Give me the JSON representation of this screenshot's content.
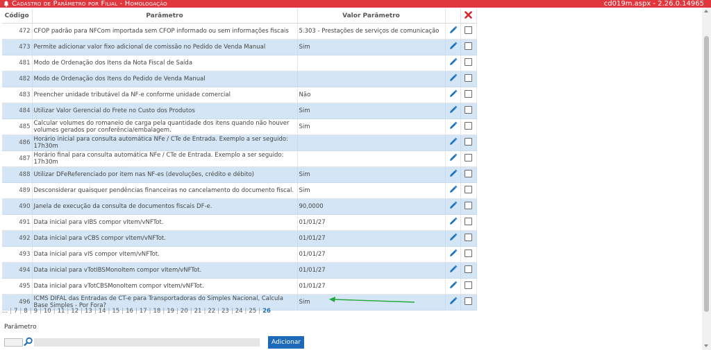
{
  "header": {
    "title": "Cadastro de Parâmetro por Filial  - Homologação",
    "version": "cd019m.aspx - 2.26.0.14965",
    "color": "#e0363e"
  },
  "table": {
    "columns": [
      "Código",
      "Parâmetro",
      "Valor Parâmetro"
    ],
    "delete_icon": "red-x-icon",
    "rows": [
      {
        "code": "472",
        "param": "CFOP padrão para NFCom importada sem CFOP informado ou sem informações fiscais",
        "value": "5.303 - Prestações de serviços de comunicação"
      },
      {
        "code": "473",
        "param": "Permite adicionar valor fixo adicional de comissão no Pedido de Venda Manual",
        "value": "Sim"
      },
      {
        "code": "481",
        "param": "Modo de Ordenação dos Itens da Nota Fiscal de Saída",
        "value": ""
      },
      {
        "code": "482",
        "param": "Modo de Ordenação dos Itens do Pedido de Venda Manual",
        "value": ""
      },
      {
        "code": "483",
        "param": "Preencher unidade tributável da NF-e conforme unidade comercial",
        "value": "Não"
      },
      {
        "code": "484",
        "param": "Utilizar Valor Gerencial do Frete no Custo dos Produtos",
        "value": "Sim"
      },
      {
        "code": "485",
        "param": "Calcular volumes do romaneio de carga pela quantidade dos itens quando não houver volumes gerados por conferência/embalagem.",
        "value": "Sim"
      },
      {
        "code": "486",
        "param": "Horário inicial para consulta automática NFe / CTe de Entrada. Exemplo a ser seguido: 17h30m",
        "value": ""
      },
      {
        "code": "487",
        "param": "Horário final para consulta automática NFe / CTe de Entrada. Exemplo a ser seguido: 17h30m",
        "value": ""
      },
      {
        "code": "488",
        "param": "Utilizar DFeReferenciado por item nas NF-es (devoluções, crédito e débito)",
        "value": "Sim"
      },
      {
        "code": "489",
        "param": "Desconsiderar quaisquer pendências financeiras no cancelamento do documento fiscal.",
        "value": "Sim"
      },
      {
        "code": "490",
        "param": "Janela de execução da consulta de documentos fiscais DF-e.",
        "value": "90,0000"
      },
      {
        "code": "491",
        "param": "Data inicial para vIBS compor vItem/vNFTot.",
        "value": "01/01/27"
      },
      {
        "code": "492",
        "param": "Data inicial para vCBS compor vItem/vNFTot.",
        "value": "01/01/27"
      },
      {
        "code": "493",
        "param": "Data inicial para vIS compor vItem/vNFTot.",
        "value": "01/01/27"
      },
      {
        "code": "494",
        "param": "Data inicial para vTotIBSMonoItem compor vItem/vNFTot.",
        "value": "01/01/27"
      },
      {
        "code": "495",
        "param": "Data inicial para vTotCBSMonoItem compor vItem/vNFTot.",
        "value": "01/01/27"
      },
      {
        "code": "496",
        "param": "ICMS DIFAL das Entradas de CT-e para Transportadoras do Simples Nacional, Calcula Base Simples - Por Fora?",
        "value": "Sim"
      }
    ]
  },
  "pager": {
    "pages": [
      "...",
      "7",
      "8",
      "9",
      "10",
      "11",
      "12",
      "13",
      "14",
      "15",
      "16",
      "17",
      "18",
      "19",
      "20",
      "21",
      "22",
      "23",
      "24",
      "25",
      "26"
    ],
    "current": "26"
  },
  "form": {
    "label": "Parâmetro",
    "code_value": "",
    "description_value": "",
    "add_label": "Adicionar",
    "search_icon": "magnifier-icon"
  },
  "colors": {
    "accent": "#1d6bb8",
    "row_alt": "#d4e6f5",
    "annotation_arrow": "#22a83a"
  }
}
